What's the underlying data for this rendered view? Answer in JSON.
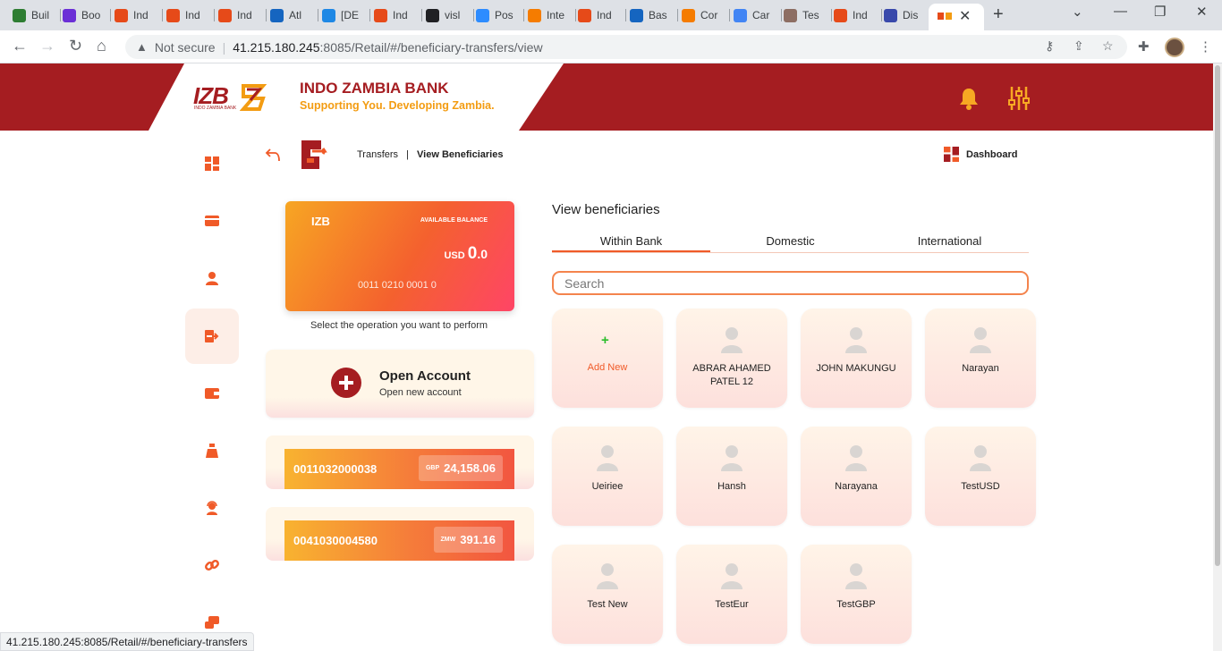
{
  "browser": {
    "tabs": [
      {
        "label": "Buil",
        "color": "#2e7d32"
      },
      {
        "label": "Boo",
        "color": "#6b2fd6"
      },
      {
        "label": "Ind",
        "color": "#e64a19"
      },
      {
        "label": "Ind",
        "color": "#e64a19"
      },
      {
        "label": "Ind",
        "color": "#e64a19"
      },
      {
        "label": "Atl",
        "color": "#1565c0"
      },
      {
        "label": "[DE",
        "color": "#1e88e5"
      },
      {
        "label": "Ind",
        "color": "#e64a19"
      },
      {
        "label": "visl",
        "color": "#202124"
      },
      {
        "label": "Pos",
        "color": "#2d8cff"
      },
      {
        "label": "Inte",
        "color": "#f57c00"
      },
      {
        "label": "Ind",
        "color": "#e64a19"
      },
      {
        "label": "Bas",
        "color": "#1565c0"
      },
      {
        "label": "Cor",
        "color": "#f57c00"
      },
      {
        "label": "Car",
        "color": "#4285f4"
      },
      {
        "label": "Tes",
        "color": "#8d6e63"
      },
      {
        "label": "Ind",
        "color": "#e64a19"
      },
      {
        "label": "Dis",
        "color": "#3949ab"
      }
    ],
    "new_tab": "+",
    "url_warning": "Not secure",
    "url_host": "41.215.180.245",
    "url_path": ":8085/Retail/#/beneficiary-transfers/view",
    "status_url": "41.215.180.245:8085/Retail/#/beneficiary-transfers"
  },
  "header": {
    "logo_text": "IZB",
    "logo_sub": "INDO ZAMBIA BANK",
    "bank_name": "INDO ZAMBIA BANK",
    "tagline": "Supporting You. Developing Zambia."
  },
  "colors": {
    "brand_red": "#a51d21",
    "accent_orange": "#f05a28",
    "tagline_gold": "#f39c12"
  },
  "breadcrumb": {
    "section": "Transfers",
    "separator": "|",
    "page": "View Beneficiaries"
  },
  "dashboard_link": "Dashboard",
  "balance_card": {
    "brand": "IZB",
    "available_label": "AVAILABLE BALANCE",
    "currency": "USD",
    "amount_int": "0",
    "amount_dec": ".0",
    "account_number": "0011 0210 0001 0"
  },
  "select_operation": "Select the operation you want to perform",
  "open_account": {
    "title": "Open Account",
    "subtitle": "Open new account"
  },
  "accounts": [
    {
      "number": "0011032000038",
      "currency": "GBP",
      "balance": "24,158.06"
    },
    {
      "number": "0041030004580",
      "currency": "ZMW",
      "balance": "391.16"
    }
  ],
  "beneficiaries": {
    "title": "View beneficiaries",
    "tabs": [
      "Within Bank",
      "Domestic",
      "International"
    ],
    "search_placeholder": "Search",
    "add_new_label": "Add New",
    "items": [
      "ABRAR AHAMED PATEL 12",
      "JOHN MAKUNGU",
      "Narayan",
      "Ueiriee",
      "Hansh",
      "Narayana",
      "TestUSD",
      "Test New",
      "TestEur",
      "TestGBP"
    ]
  }
}
